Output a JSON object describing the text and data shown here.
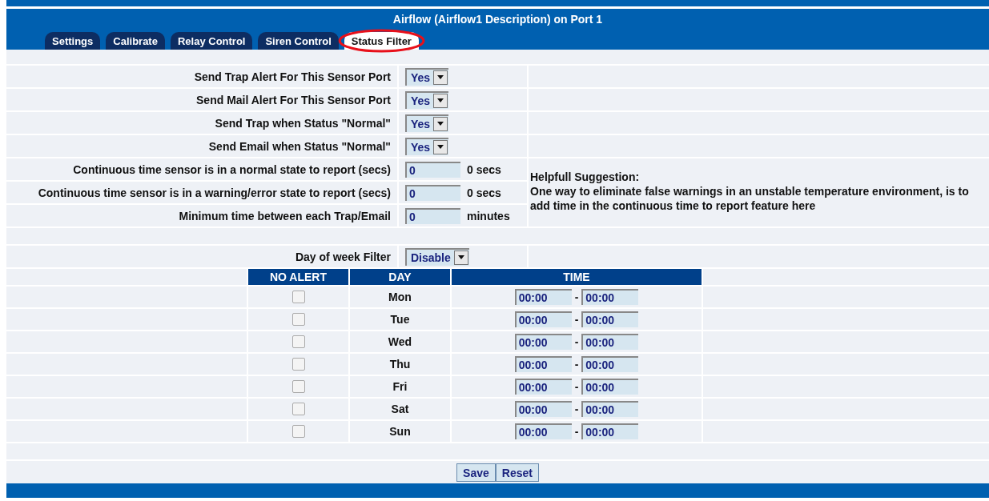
{
  "header": {
    "title": "Airflow (Airflow1 Description) on Port 1"
  },
  "tabs": [
    {
      "label": "Settings",
      "selected": false,
      "circled": false
    },
    {
      "label": "Calibrate",
      "selected": false,
      "circled": false
    },
    {
      "label": "Relay Control",
      "selected": false,
      "circled": false
    },
    {
      "label": "Siren Control",
      "selected": false,
      "circled": false
    },
    {
      "label": "Status Filter",
      "selected": true,
      "circled": true
    }
  ],
  "alerts": [
    {
      "label": "Send Trap Alert For This Sensor Port",
      "value": "Yes"
    },
    {
      "label": "Send Mail Alert For This Sensor Port",
      "value": "Yes"
    },
    {
      "label": "Send Trap when Status \"Normal\"",
      "value": "Yes"
    },
    {
      "label": "Send Email when Status \"Normal\"",
      "value": "Yes"
    }
  ],
  "timings": [
    {
      "label": "Continuous time sensor is in a normal state to report (secs)",
      "value": "0",
      "unit": "0 secs"
    },
    {
      "label": "Continuous time sensor is in a warning/error state to report (secs)",
      "value": "0",
      "unit": "0 secs"
    },
    {
      "label": "Minimum time between each Trap/Email",
      "value": "0",
      "unit": "minutes"
    }
  ],
  "suggestion": {
    "title": "Helpfull Suggestion:",
    "text": "One way to eliminate false warnings in an unstable temperature environment, is to add time in the continuous time to report feature here"
  },
  "day_filter": {
    "label": "Day of week Filter",
    "value": "Disable"
  },
  "schedule": {
    "columns": [
      "NO ALERT",
      "DAY",
      "TIME"
    ],
    "rows": [
      {
        "day": "Mon",
        "no_alert": false,
        "start": "00:00",
        "separator": "-",
        "end": "00:00"
      },
      {
        "day": "Tue",
        "no_alert": false,
        "start": "00:00",
        "separator": "-",
        "end": "00:00"
      },
      {
        "day": "Wed",
        "no_alert": false,
        "start": "00:00",
        "separator": "-",
        "end": "00:00"
      },
      {
        "day": "Thu",
        "no_alert": false,
        "start": "00:00",
        "separator": "-",
        "end": "00:00"
      },
      {
        "day": "Fri",
        "no_alert": false,
        "start": "00:00",
        "separator": "-",
        "end": "00:00"
      },
      {
        "day": "Sat",
        "no_alert": false,
        "start": "00:00",
        "separator": "-",
        "end": "00:00"
      },
      {
        "day": "Sun",
        "no_alert": false,
        "start": "00:00",
        "separator": "-",
        "end": "00:00"
      }
    ]
  },
  "buttons": [
    "Save",
    "Reset"
  ]
}
